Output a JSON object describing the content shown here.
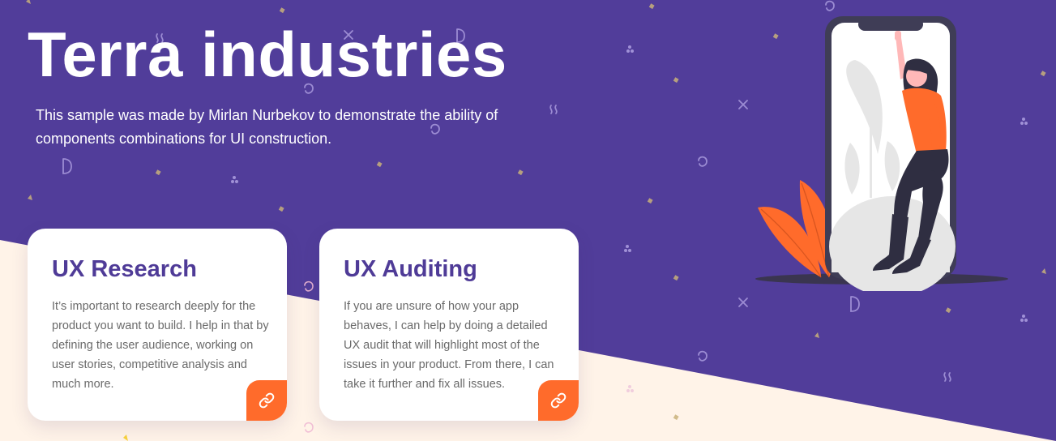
{
  "hero": {
    "title": "Terra industries",
    "subtitle": "This sample was made by Mirlan Nurbekov to demonstrate the ability of components combinations for UI construction."
  },
  "cards": [
    {
      "title": "UX Research",
      "text": "It’s important to research deeply for the product you want to build. I help in that by defining the user audience, working on user stories, competitive analysis and much more.",
      "link_icon": "link-icon"
    },
    {
      "title": "UX Auditing",
      "text": "If you are unsure of how your app behaves, I can help by doing a detailed UX audit that will highlight most of the issues in your product. From there, I can take it further and fix all issues.",
      "link_icon": "link-icon"
    }
  ],
  "colors": {
    "hero_purple": "#513D9A",
    "cream": "#FFF3E8",
    "accent_orange": "#FF6B2B",
    "card_title": "#4F3B97",
    "body_text": "#6A6A6A"
  }
}
